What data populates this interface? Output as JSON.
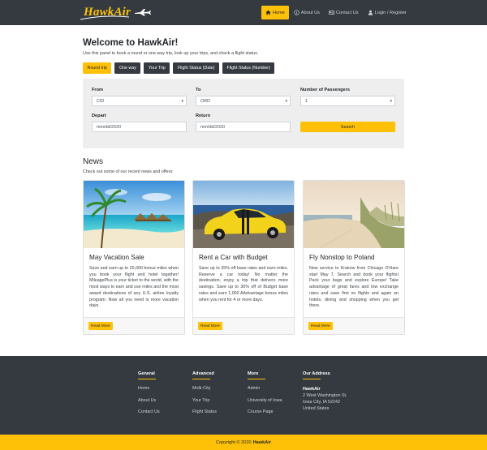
{
  "nav": {
    "brand": "HawkAir",
    "items": [
      {
        "label": "Home",
        "icon": "home-icon",
        "active": true
      },
      {
        "label": "About Us",
        "icon": "info-icon",
        "active": false
      },
      {
        "label": "Contact Us",
        "icon": "address-card-icon",
        "active": false
      },
      {
        "label": "Login / Register",
        "icon": "user-icon",
        "active": false
      }
    ]
  },
  "welcome": {
    "title": "Welcome to HawkAir!",
    "subtitle": "Use this panel to book a round or one way trip, look up your trips, and check a flight status."
  },
  "tabs": [
    "Round trip",
    "One way",
    "Your Trip",
    "Flight Status (Date)",
    "Flight Status (Number)"
  ],
  "form": {
    "from_label": "From",
    "from_value": "CID",
    "to_label": "To",
    "to_value": "ORD",
    "passengers_label": "Number of Passengers",
    "passengers_value": "1",
    "depart_label": "Depart",
    "depart_placeholder": "mm/dd/2020",
    "return_label": "Return",
    "return_placeholder": "mm/dd/2020",
    "search_label": "Search"
  },
  "news": {
    "title": "News",
    "subtitle": "Check out some of our recent news and offers:",
    "cards": [
      {
        "title": "May Vacation Sale",
        "text": "Save and earn up to 25,000 bonus miles when you book your flight and hotel together! MileagePlus is your ticket to the world, with the most ways to earn and use miles and the most award destinations of any U.S. airline loyalty program. Now all you need is more vacation days.",
        "button": "Read More"
      },
      {
        "title": "Rent a Car with Budget",
        "text": "Save up to 35% off base rates and earn miles. Reserve a car today! No matter the destination, enjoy a trip that delivers more savings. Save up to 30% off of Budget base rates and earn 1,000 AAdvantage bonus miles when you rent for 4 or more days.",
        "button": "Read More"
      },
      {
        "title": "Fly Nonstop to Poland",
        "text": "New service to Krakow from Chicago O'Hare start May 7. Search and book your flights! Pack your bags and explore Europe! Take advantage of great fares and low exchange rates and save first on flights and again on hotels, dining and shopping when you get there.",
        "button": "Read More"
      }
    ]
  },
  "footer": {
    "general": {
      "heading": "General",
      "links": [
        "Home",
        "About Us",
        "Contact Us"
      ]
    },
    "advanced": {
      "heading": "Advanced",
      "links": [
        "Multi-City",
        "Your Trip",
        "Flight Status"
      ]
    },
    "more": {
      "heading": "More",
      "links": [
        "Admin",
        "University of Iowa",
        "Course Page"
      ]
    },
    "address": {
      "heading": "Our Address",
      "name": "HawkAir",
      "street": "2 West Washington St.",
      "city": "Iowa City, IA 52242",
      "country": "United States"
    },
    "copyright": "Copyright © 2020",
    "copyright_brand": "HawkAir"
  },
  "colors": {
    "accent": "#ffc107",
    "dark": "#343a40",
    "panel": "#eeeeee"
  }
}
